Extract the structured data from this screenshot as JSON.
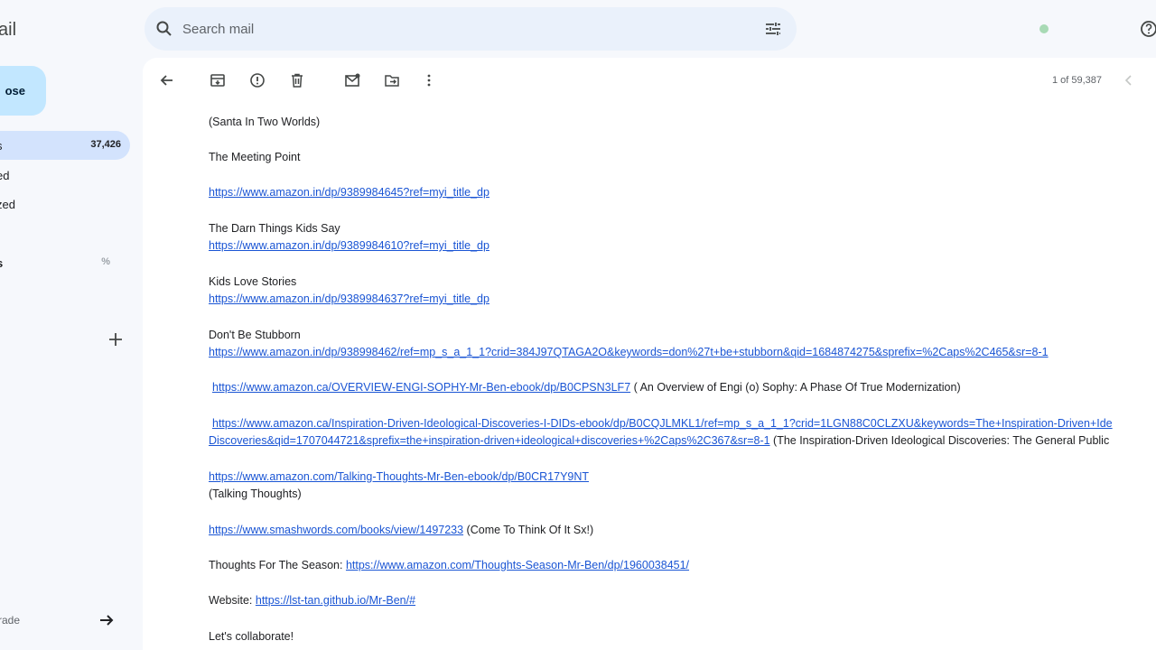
{
  "sidebar": {
    "logo": "ail",
    "compose_label": "ose",
    "items": [
      {
        "label": "s",
        "count": "37,426"
      },
      {
        "label": "ed"
      },
      {
        "label": "zed"
      },
      {
        "label": "s",
        "count": "%"
      }
    ],
    "upgrade_label": "rade"
  },
  "search": {
    "placeholder": "Search mail"
  },
  "toolbar": {
    "pager": "1 of 59,387"
  },
  "email": {
    "lines": {
      "l1": "(Santa In Two Worlds)",
      "l2": "The Meeting Point",
      "l3_link": "https://www.amazon.in/dp/9389984645?ref=myi_title_dp",
      "l4": "The Darn Things Kids Say",
      "l5_link": "https://www.amazon.in/dp/9389984610?ref=myi_title_dp",
      "l6": "Kids Love Stories",
      "l7_link": "https://www.amazon.in/dp/9389984637?ref=myi_title_dp",
      "l8": "Don't Be Stubborn",
      "l9_link": "https://www.amazon.in/dp/938998462/ref=mp_s_a_1_1?crid=384J97QTAGA2O&keywords=don%27t+be+stubborn&qid=1684874275&sprefix=%2Caps%2C465&sr=8-1",
      "l10_link": "https://www.amazon.ca/OVERVIEW-ENGI-SOPHY-Mr-Ben-ebook/dp/B0CPSN3LF7",
      "l10_text": " ( An Overview of Engi (o) Sophy: A Phase Of True Modernization)",
      "l11_link": "https://www.amazon.ca/Inspiration-Driven-Ideological-Discoveries-I-DIDs-ebook/dp/B0CQJLMKL1/ref=mp_s_a_1_1?crid=1LGN88C0CLZXU&keywords=The+Inspiration-Driven+Ide",
      "l12_link": "Discoveries&qid=1707044721&sprefix=the+inspiration-driven+ideological+discoveries+%2Caps%2C367&sr=8-1",
      "l12_text": " (The Inspiration-Driven Ideological Discoveries: The General Public",
      "l13_link": "https://www.amazon.com/Talking-Thoughts-Mr-Ben-ebook/dp/B0CR17Y9NT",
      "l14": "(Talking Thoughts)",
      "l15_link": "https://www.smashwords.com/books/view/1497233",
      "l15_text": " (Come To Think Of It Sx!)",
      "l16_text": "Thoughts For The Season: ",
      "l16_link": "https://www.amazon.com/Thoughts-Season-Mr-Ben/dp/1960038451/",
      "l17_text": "Website: ",
      "l17_link": "https://lst-tan.github.io/Mr-Ben/#",
      "l18": "Let's collaborate!"
    }
  },
  "colors": {
    "accent": "#c2e7ff",
    "active_nav": "#d3e3fd",
    "link": "#1a55d4"
  }
}
